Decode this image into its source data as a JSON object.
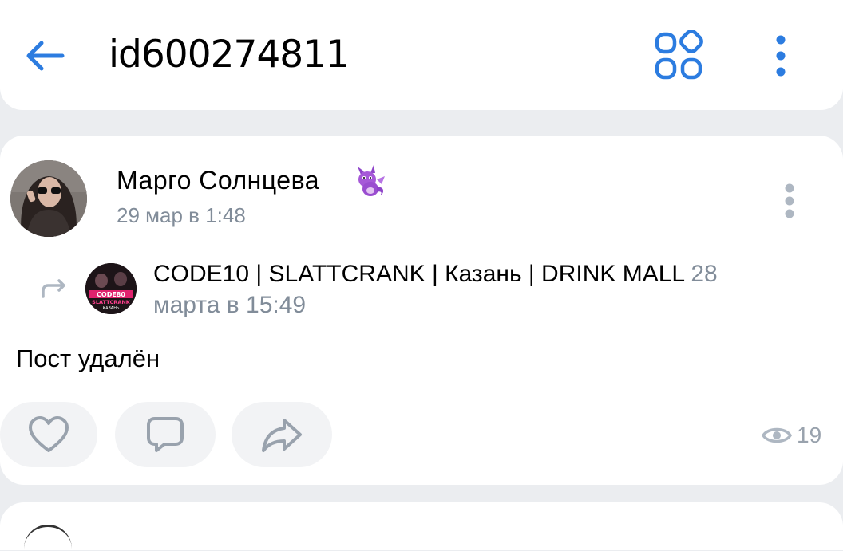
{
  "header": {
    "title": "id600274811"
  },
  "post": {
    "author": "Марго Солнцева",
    "time": "29 мар в 1:48",
    "repost": {
      "source": "CODE10 | SLATTCRANK | Казань | DRINK MALL",
      "time": "28 марта в 15:49",
      "avatar_text": [
        "CODE80",
        "SLATTCRANK",
        "КАЗАНЬ"
      ]
    },
    "text": "Пост удалён",
    "views": "19"
  },
  "colors": {
    "accent": "#2c7ce0",
    "secondary_text": "#818c99",
    "icon_gray": "#99a2ad",
    "background": "#ebedf0"
  }
}
